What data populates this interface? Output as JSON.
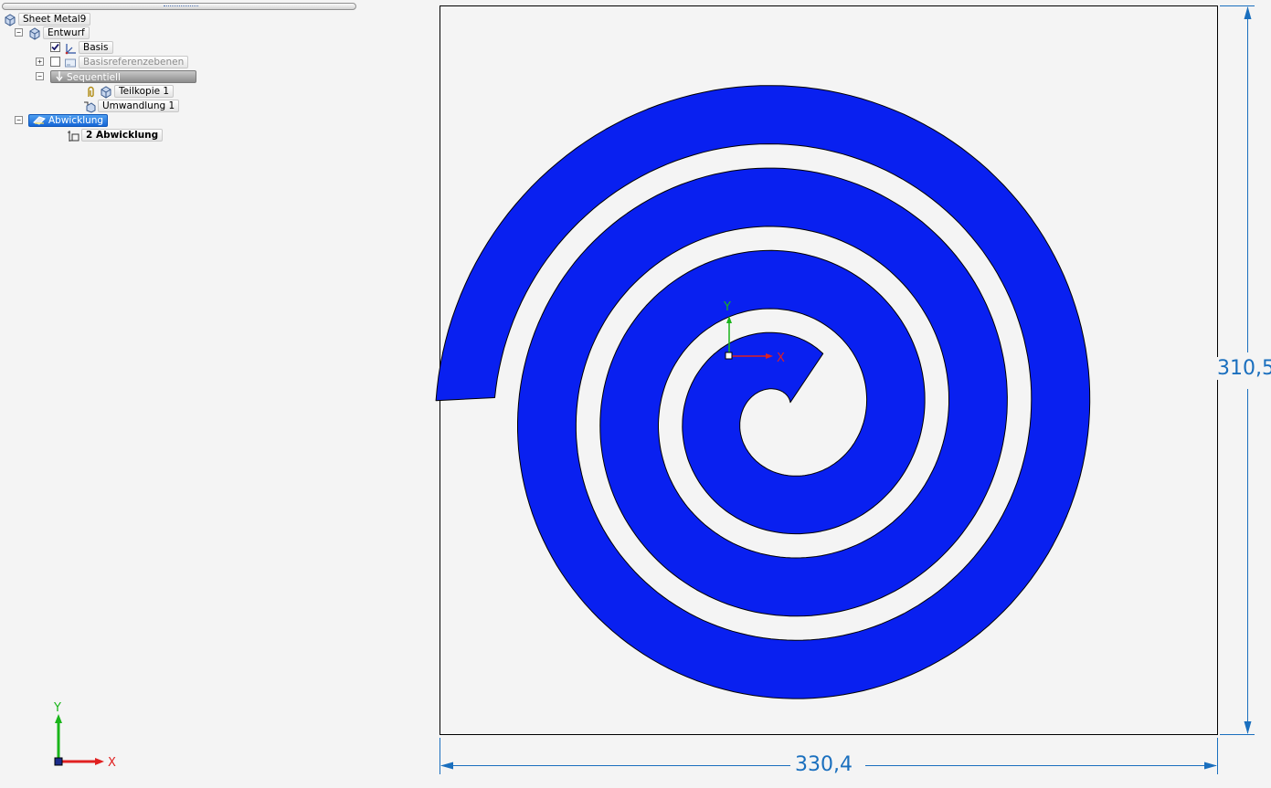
{
  "feature_tree": {
    "root": {
      "label": "Sheet Metal9"
    },
    "entwurf": {
      "label": "Entwurf"
    },
    "basis": {
      "label": "Basis",
      "checked": true
    },
    "basisreferenzebenen": {
      "label": "Basisreferenzebenen",
      "checked": false
    },
    "sequentiell": {
      "label": "Sequentiell"
    },
    "teilkopie": {
      "label": "Teilkopie 1"
    },
    "umwandlung": {
      "label": "Umwandlung 1"
    },
    "abwicklung": {
      "label": "Abwicklung"
    },
    "abwicklung_child": {
      "label": "2 Abwicklung"
    }
  },
  "triad": {
    "x_label": "X",
    "y_label": "Y"
  },
  "drawing": {
    "width_dimension": "330,4",
    "height_dimension": "310,5",
    "fill_color": "#0920f0",
    "dimension_color": "#1a6fbe",
    "origin_x_label": "X",
    "origin_y_label": "Y"
  }
}
